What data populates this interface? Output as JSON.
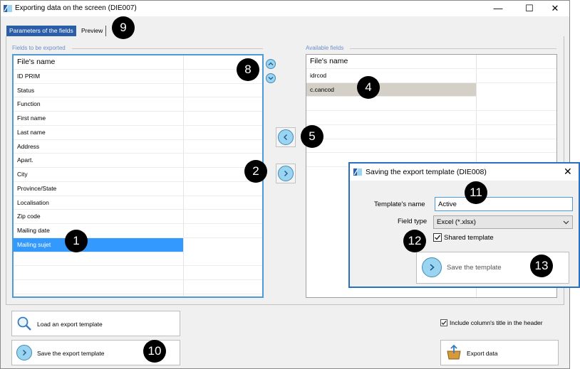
{
  "window": {
    "title": "Exporting data on the screen (DIE007)",
    "minimize": "—",
    "maximize": "☐",
    "close": "✕"
  },
  "tabs": [
    {
      "label": "Parameters of the fields",
      "active": true
    },
    {
      "label": "Preview",
      "active": false
    }
  ],
  "fields_to_export": {
    "group_label": "Fields to be exported",
    "header": "File's name",
    "items": [
      "ID PRIM",
      "Status",
      "Function",
      "First name",
      "Last name",
      "Address",
      "Apart.",
      "City",
      "Province/State",
      "Localisation",
      "Zip code",
      "Mailing date",
      "Mailing sujet"
    ],
    "selected": "Mailing sujet"
  },
  "available_fields": {
    "group_label": "Available fields",
    "header": "File's name",
    "items": [
      "idrcod",
      "c.cancod"
    ],
    "selected": "c.cancod"
  },
  "dialog": {
    "title": "Saving the export template (DIE008)",
    "close": "✕",
    "template_name_label": "Template's name",
    "template_name_value": "Active",
    "field_type_label": "Field type",
    "field_type_value": "Excel (*.xlsx)",
    "shared_template_label": "Shared template",
    "shared_checked": true,
    "save_button_label": "Save the template"
  },
  "bottom": {
    "load_button": "Load an export template",
    "save_button": "Save the export template",
    "include_titles_label": "Include column's title in the header",
    "include_checked": true,
    "export_button": "Export data"
  },
  "callouts": {
    "c1": "1",
    "c2": "2",
    "c4": "4",
    "c5": "5",
    "c8": "8",
    "c9": "9",
    "c10": "10",
    "c11": "11",
    "c12": "12",
    "c13": "13"
  },
  "colors": {
    "accent_tab": "#2a5ea8",
    "selection": "#3399ff",
    "selection_gray": "#d4d0c8",
    "focus_border": "#4a9bd8",
    "round_button_fill": "#9ad4f0"
  }
}
